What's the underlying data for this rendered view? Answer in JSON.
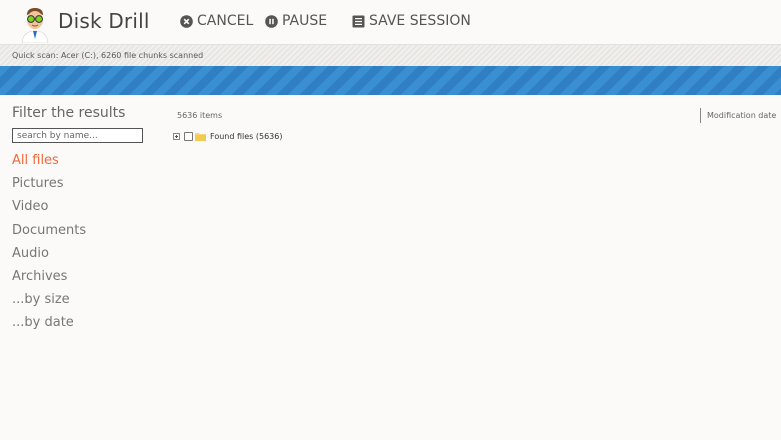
{
  "app": {
    "title": "Disk Drill"
  },
  "toolbar": {
    "cancel_label": "CANCEL",
    "pause_label": "PAUSE",
    "save_label": "SAVE SESSION"
  },
  "status": {
    "text": "Quick scan: Acer (C:), 6260 file chunks scanned"
  },
  "sidebar": {
    "title": "Filter the results",
    "search_placeholder": "search by name...",
    "filters": [
      {
        "label": "All files",
        "active": true
      },
      {
        "label": "Pictures"
      },
      {
        "label": "Video"
      },
      {
        "label": "Documents"
      },
      {
        "label": "Audio"
      },
      {
        "label": "Archives"
      },
      {
        "label": "...by size"
      },
      {
        "label": "...by date"
      }
    ]
  },
  "results": {
    "count": "5636 items",
    "columns": [
      "Modification date"
    ],
    "tree": [
      {
        "label": "Found files (5636)",
        "icon": "folder-icon"
      }
    ]
  },
  "colors": {
    "accent": "#ef6a3a",
    "progress": "#3a8fd3",
    "background": "#fbfaf8"
  }
}
